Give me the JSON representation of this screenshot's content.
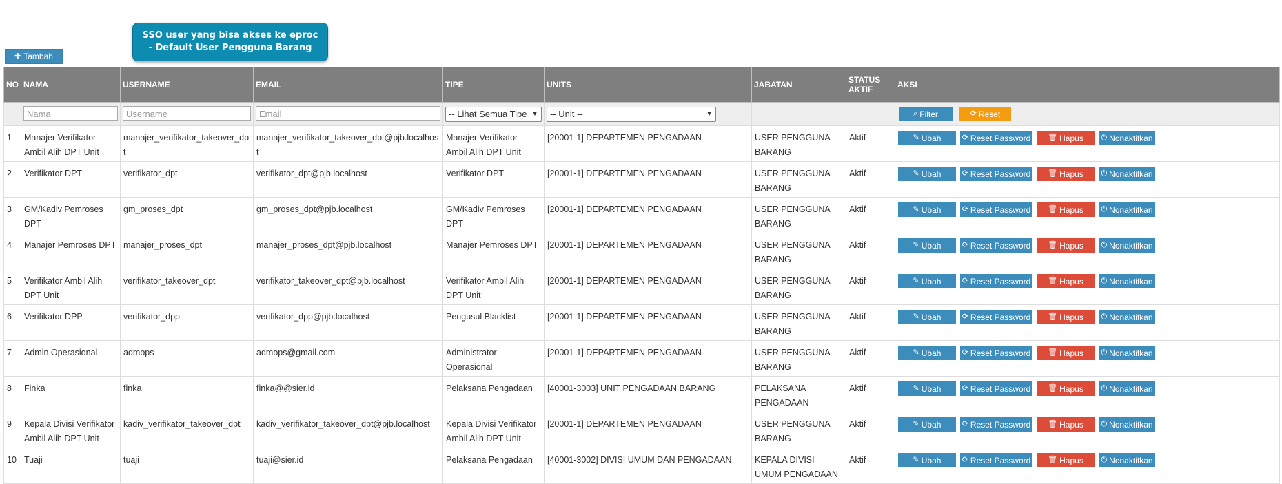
{
  "toolbar": {
    "add_label": "Tambah",
    "add_icon": "plus-icon"
  },
  "callout": {
    "line1": "SSO user yang bisa akses ke eproc",
    "line2": "- Default User Pengguna Barang"
  },
  "columns": {
    "no": "NO",
    "nama": "NAMA",
    "username": "USERNAME",
    "email": "EMAIL",
    "tipe": "TIPE",
    "units": "UNITS",
    "jabatan": "JABATAN",
    "status_line1": "STATUS",
    "status_line2": "AKTIF",
    "aksi": "AKSI"
  },
  "filters": {
    "nama_placeholder": "Nama",
    "username_placeholder": "Username",
    "email_placeholder": "Email",
    "tipe_selected": "-- Lihat Semua Tipe",
    "unit_selected": "-- Unit --",
    "filter_label": "Filter",
    "reset_label": "Reset"
  },
  "actions": {
    "ubah": "Ubah",
    "reset_password": "Reset Password",
    "hapus": "Hapus",
    "nonaktifkan": "Nonaktifkan"
  },
  "rows": [
    {
      "no": "1",
      "nama": "Manajer Verifikator Ambil Alih DPT Unit",
      "username": "manajer_verifikator_takeover_dpt",
      "email": "manajer_verifikator_takeover_dpt@pjb.localhost",
      "tipe": "Manajer Verifikator Ambil Alih DPT Unit",
      "units": "[20001-1] DEPARTEMEN PENGADAAN",
      "jabatan": "USER PENGGUNA BARANG",
      "status": "Aktif"
    },
    {
      "no": "2",
      "nama": "Verifikator DPT",
      "username": "verifikator_dpt",
      "email": "verifikator_dpt@pjb.localhost",
      "tipe": "Verifikator DPT",
      "units": "[20001-1] DEPARTEMEN PENGADAAN",
      "jabatan": "USER PENGGUNA BARANG",
      "status": "Aktif"
    },
    {
      "no": "3",
      "nama": "GM/Kadiv Pemroses DPT",
      "username": "gm_proses_dpt",
      "email": "gm_proses_dpt@pjb.localhost",
      "tipe": "GM/Kadiv Pemroses DPT",
      "units": "[20001-1] DEPARTEMEN PENGADAAN",
      "jabatan": "USER PENGGUNA BARANG",
      "status": "Aktif"
    },
    {
      "no": "4",
      "nama": "Manajer Pemroses DPT",
      "username": "manajer_proses_dpt",
      "email": "manajer_proses_dpt@pjb.localhost",
      "tipe": "Manajer Pemroses DPT",
      "units": "[20001-1] DEPARTEMEN PENGADAAN",
      "jabatan": "USER PENGGUNA BARANG",
      "status": "Aktif"
    },
    {
      "no": "5",
      "nama": "Verifikator Ambil Alih DPT Unit",
      "username": "verifikator_takeover_dpt",
      "email": "verifikator_takeover_dpt@pjb.localhost",
      "tipe": "Verifikator Ambil Alih DPT Unit",
      "units": "[20001-1] DEPARTEMEN PENGADAAN",
      "jabatan": "USER PENGGUNA BARANG",
      "status": "Aktif"
    },
    {
      "no": "6",
      "nama": "Verifikator DPP",
      "username": "verifikator_dpp",
      "email": "verifikator_dpp@pjb.localhost",
      "tipe": "Pengusul Blacklist",
      "units": "[20001-1] DEPARTEMEN PENGADAAN",
      "jabatan": "USER PENGGUNA BARANG",
      "status": "Aktif"
    },
    {
      "no": "7",
      "nama": "Admin Operasional",
      "username": "admops",
      "email": "admops@gmail.com",
      "tipe": "Administrator Operasional",
      "units": "[20001-1] DEPARTEMEN PENGADAAN",
      "jabatan": "USER PENGGUNA BARANG",
      "status": "Aktif"
    },
    {
      "no": "8",
      "nama": "Finka",
      "username": "finka",
      "email": "finka@@sier.id",
      "tipe": "Pelaksana Pengadaan",
      "units": "[40001-3003] UNIT PENGADAAN BARANG",
      "jabatan": "PELAKSANA PENGADAAN",
      "status": "Aktif"
    },
    {
      "no": "9",
      "nama": "Kepala Divisi Verifikator Ambil Alih DPT Unit",
      "username": "kadiv_verifikator_takeover_dpt",
      "email": "kadiv_verifikator_takeover_dpt@pjb.localhost",
      "tipe": "Kepala Divisi Verifikator Ambil Alih DPT Unit",
      "units": "[20001-1] DEPARTEMEN PENGADAAN",
      "jabatan": "USER PENGGUNA BARANG",
      "status": "Aktif"
    },
    {
      "no": "10",
      "nama": "Tuaji",
      "username": "tuaji",
      "email": "tuaji@sier.id",
      "tipe": "Pelaksana Pengadaan",
      "units": "[40001-3002] DIVISI UMUM DAN PENGADAAN",
      "jabatan": "KEPALA DIVISI UMUM PENGADAAN",
      "status": "Aktif"
    }
  ]
}
